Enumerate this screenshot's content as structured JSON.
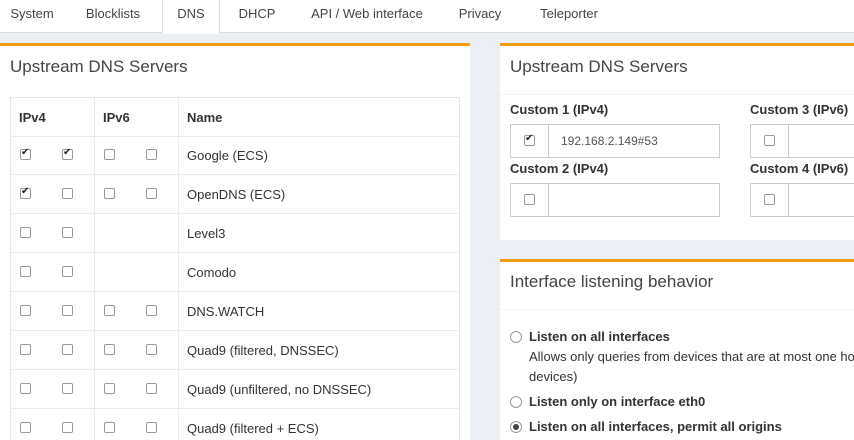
{
  "tabs": [
    {
      "label": "System"
    },
    {
      "label": "Blocklists"
    },
    {
      "label": "DNS",
      "active": true
    },
    {
      "label": "DHCP"
    },
    {
      "label": "API / Web interface"
    },
    {
      "label": "Privacy"
    },
    {
      "label": "Teleporter"
    }
  ],
  "left_box": {
    "title": "Upstream DNS Servers",
    "headers": {
      "ipv4": "IPv4",
      "ipv6": "IPv6",
      "name": "Name"
    },
    "rows": [
      {
        "name": "Google (ECS)",
        "v4a": true,
        "v4b": true,
        "v6a": false,
        "v6b": false,
        "has_v6": true
      },
      {
        "name": "OpenDNS (ECS)",
        "v4a": true,
        "v4b": false,
        "v6a": false,
        "v6b": false,
        "has_v6": true
      },
      {
        "name": "Level3",
        "v4a": false,
        "v4b": false,
        "has_v6": false
      },
      {
        "name": "Comodo",
        "v4a": false,
        "v4b": false,
        "has_v6": false
      },
      {
        "name": "DNS.WATCH",
        "v4a": false,
        "v4b": false,
        "v6a": false,
        "v6b": false,
        "has_v6": true
      },
      {
        "name": "Quad9 (filtered, DNSSEC)",
        "v4a": false,
        "v4b": false,
        "v6a": false,
        "v6b": false,
        "has_v6": true
      },
      {
        "name": "Quad9 (unfiltered, no DNSSEC)",
        "v4a": false,
        "v4b": false,
        "v6a": false,
        "v6b": false,
        "has_v6": true
      },
      {
        "name": "Quad9 (filtered + ECS)",
        "v4a": false,
        "v4b": false,
        "v6a": false,
        "v6b": false,
        "has_v6": true
      }
    ]
  },
  "right_box": {
    "title": "Upstream DNS Servers",
    "custom1": {
      "label": "Custom 1 (IPv4)",
      "value": "192.168.2.149#53",
      "checked": true
    },
    "custom2": {
      "label": "Custom 2 (IPv4)",
      "value": "",
      "checked": false
    },
    "custom3": {
      "label": "Custom 3 (IPv6)",
      "value": "",
      "checked": false
    },
    "custom4": {
      "label": "Custom 4 (IPv6)",
      "value": "",
      "checked": false
    }
  },
  "interface_box": {
    "title": "Interface listening behavior",
    "options": [
      {
        "label": "Listen on all interfaces",
        "desc": "Allows only queries from devices that are at most one ho",
        "desc2": "devices)",
        "selected": false
      },
      {
        "label": "Listen only on interface eth0",
        "selected": false
      },
      {
        "label": "Listen on all interfaces, permit all origins",
        "selected": true
      }
    ]
  },
  "colors": {
    "accent": "#f39c12",
    "background": "#ecf0f5"
  }
}
